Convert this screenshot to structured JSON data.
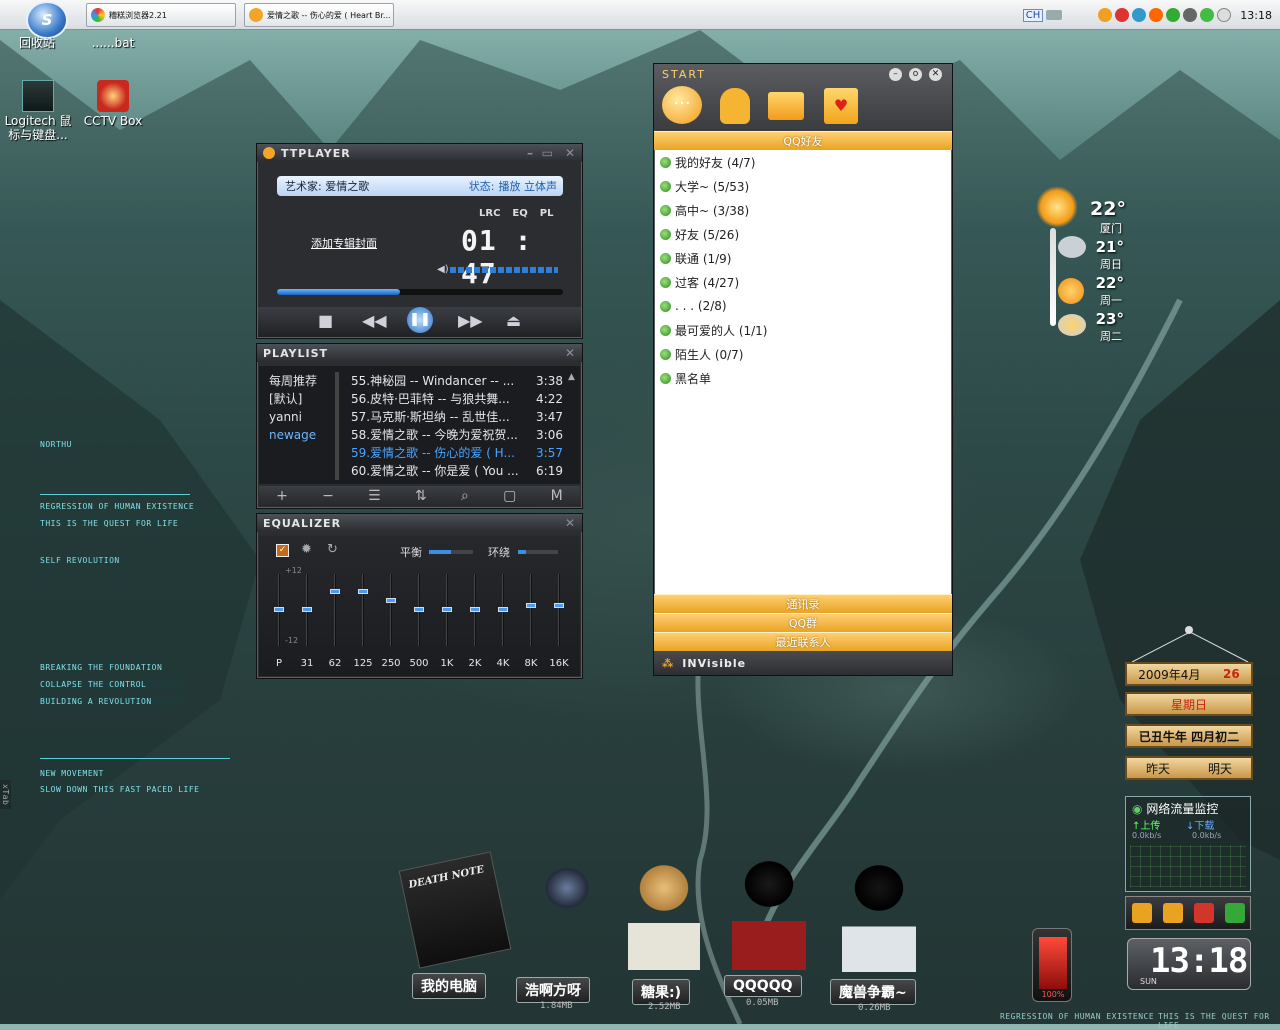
{
  "taskbar": {
    "start_label": "S",
    "tasks": [
      {
        "label": "糟糕浏览器2.21"
      },
      {
        "label": "爱情之歌 -- 伤心的爱 ( Heart Br..."
      }
    ],
    "tray_lang": "CH",
    "clock": "13:18"
  },
  "desktop_icons": [
    {
      "label": "回收站"
    },
    {
      "label": "......bat"
    },
    {
      "label": "Logitech 鼠标与键盘..."
    },
    {
      "label": "CCTV Box"
    }
  ],
  "hud": {
    "logo": "NORTHU",
    "lines": [
      "REGRESSION OF HUMAN EXISTENCE",
      "THIS IS THE QUEST FOR LIFE",
      "SELF REVOLUTION",
      "BREAKING THE FOUNDATION",
      "COLLAPSE THE CONTROL",
      "BUILDING A REVOLUTION",
      "NEW MOVEMENT",
      "SLOW DOWN THIS FAST PACED LIFE"
    ],
    "side_tab": "xTab"
  },
  "ttplayer": {
    "title": "TTPLAYER",
    "artist_label": "艺术家: 爱情之歌",
    "status_label": "状态:",
    "status_value": "播放 立体声",
    "lrc": "LRC",
    "eq": "EQ",
    "pl": "PL",
    "add_cover": "添加专辑封面",
    "time": "01 : 47",
    "progress": 0.43,
    "volume": 0.72,
    "playlist_title": "PLAYLIST",
    "playlists": [
      "每周推荐",
      "[默认]",
      "yanni",
      "newage"
    ],
    "tracks": [
      {
        "title": "55.神秘园 -- Windancer -- ...",
        "dur": "3:38"
      },
      {
        "title": "56.皮特·巴菲特 -- 与狼共舞...",
        "dur": "4:22"
      },
      {
        "title": "57.马克斯·斯坦纳 -- 乱世佳...",
        "dur": "3:47"
      },
      {
        "title": "58.爱情之歌 -- 今晚为爱祝贺...",
        "dur": "3:06"
      },
      {
        "title": "59.爱情之歌 -- 伤心的爱 ( H...",
        "dur": "3:57"
      },
      {
        "title": "60.爱情之歌 -- 你是爱 ( You ...",
        "dur": "6:19"
      }
    ],
    "current_track": 4,
    "equalizer_title": "EQUALIZER",
    "eq_balance": "平衡",
    "eq_surround": "环绕",
    "eq_top": "+12",
    "eq_bottom": "-12",
    "eq_bands": [
      "P",
      "31",
      "62",
      "125",
      "250",
      "500",
      "1K",
      "2K",
      "4K",
      "8K",
      "16K"
    ],
    "eq_levels": [
      0,
      0,
      0.5,
      0.5,
      0.25,
      0,
      0,
      0,
      0,
      0.1,
      0.1
    ]
  },
  "qq": {
    "title": "START",
    "section_friends": "QQ好友",
    "groups": [
      "我的好友 (4/7)",
      "大学~ (5/53)",
      "高中~ (3/38)",
      "好友 (5/26)",
      "联通 (1/9)",
      "过客 (4/27)",
      ". . . (2/8)",
      "最可爱的人 (1/1)",
      "陌生人 (0/7)",
      "黑名单"
    ],
    "tabs": [
      "通讯录",
      "QQ群",
      "最近联系人"
    ],
    "status": "INVisible"
  },
  "weather": [
    {
      "temp": "22°",
      "place": "厦门"
    },
    {
      "temp": "21°",
      "place": "周日"
    },
    {
      "temp": "22°",
      "place": "周一"
    },
    {
      "temp": "23°",
      "place": "周二"
    }
  ],
  "calendar": {
    "year_month": "2009年4月",
    "day": "26",
    "weekday": "星期日",
    "lunar": "已丑牛年 四月初二",
    "yesterday": "昨天",
    "tomorrow": "明天"
  },
  "netmon": {
    "title": "网络流量监控",
    "up": "上传",
    "down": "下载",
    "up_val": "0.0kb/s",
    "down_val": "0.0kb/s"
  },
  "bottom_clock": "13:18",
  "bottom_clock_sub": "SUN",
  "battery": "100%",
  "figures": [
    {
      "label": "我的电脑",
      "size": ""
    },
    {
      "label": "浩啊方呀",
      "size": "1.84MB"
    },
    {
      "label": "糖果:)",
      "size": "2.52MB"
    },
    {
      "label": "QQQQQ",
      "size": "0.05MB"
    },
    {
      "label": "魔兽争霸~",
      "size": "0.26MB"
    }
  ],
  "death_note": "DEATH NOTE",
  "footer_left": "REGRESSION OF HUMAN EXISTENCE",
  "footer_right": "THIS IS THE QUEST FOR LIFE"
}
